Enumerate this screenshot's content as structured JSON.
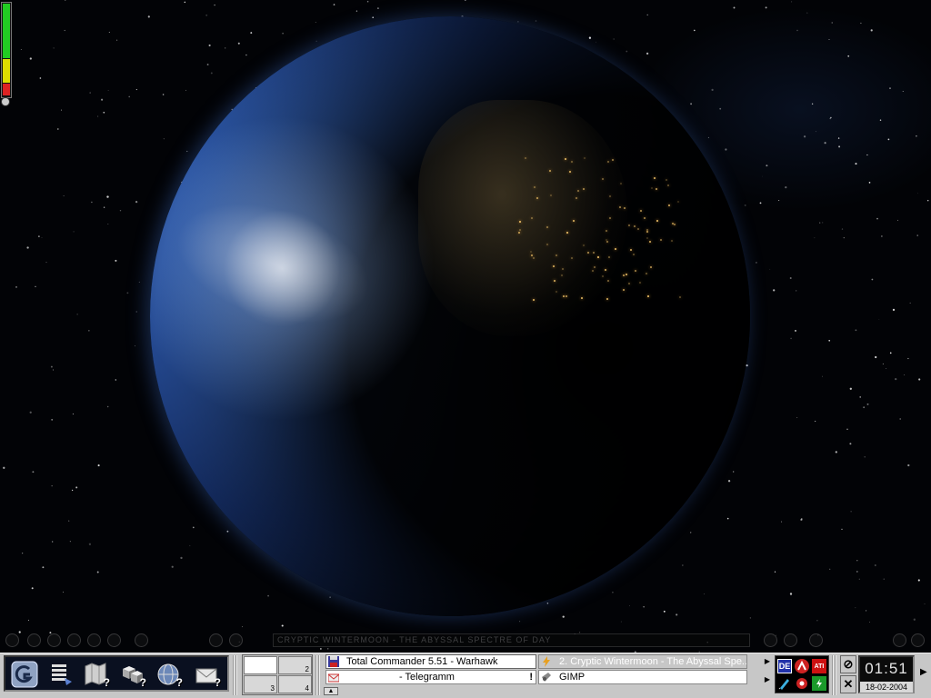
{
  "desktop": {
    "wallpaper": "earth-from-space"
  },
  "media_player": {
    "ticker": "CRYPTIC WINTERMOON - THE ABYSSAL SPECTRE OF DAY"
  },
  "launcher": {
    "items": [
      {
        "icon": "start-logo-icon"
      },
      {
        "icon": "list-menu-icon"
      },
      {
        "icon": "map-icon"
      },
      {
        "icon": "cubes-icon"
      },
      {
        "icon": "globe-icon"
      },
      {
        "icon": "mail-icon"
      }
    ]
  },
  "pager": {
    "desktops": [
      "1",
      "2",
      "3",
      "4"
    ],
    "labels": [
      "2",
      "3",
      "4"
    ]
  },
  "tasks": [
    {
      "label": "Total Commander 5.51 - Warhawk",
      "icon": "floppy-icon",
      "active": true
    },
    {
      "label": "2. Cryptic Wintermoon - The Abyssal Spe...",
      "icon": "winamp-bolt-icon",
      "active": false
    },
    {
      "label": "- Telegramm",
      "icon": "telegram-icon",
      "active": false,
      "alert": "!"
    },
    {
      "label": "GIMP",
      "icon": "gimp-icon",
      "active": false
    }
  ],
  "tray": {
    "items": [
      {
        "icon": "keyboard-lang-icon",
        "text": "DE"
      },
      {
        "icon": "network-icon",
        "text": ""
      },
      {
        "icon": "ati-icon",
        "text": "ATI"
      },
      {
        "icon": "pen-icon",
        "text": ""
      },
      {
        "icon": "bluetooth-icon",
        "text": ""
      },
      {
        "icon": "power-icon",
        "text": ""
      }
    ]
  },
  "clock": {
    "time": "01:51",
    "date": "18-02-2004"
  },
  "colors": {
    "taskbar": "#c7c7c7",
    "active_task": "#ffffff",
    "cpu_green": "#22cc22",
    "cpu_yellow": "#dddd00",
    "cpu_red": "#dd2222"
  }
}
